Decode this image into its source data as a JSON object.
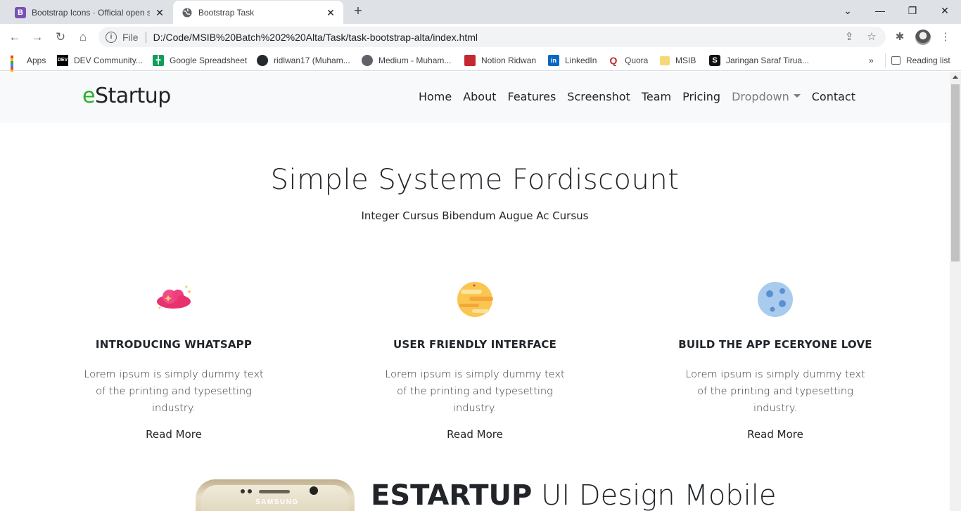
{
  "browser": {
    "tabs": [
      {
        "title": "Bootstrap Icons · Official open sc",
        "favicon": "bootstrap-icon",
        "active": false
      },
      {
        "title": "Bootstrap Task",
        "favicon": "globe-icon",
        "active": true
      }
    ],
    "url_scheme_label": "File",
    "url": "D:/Code/MSIB%20Batch%202%20Alta/Task/task-bootstrap-alta/index.html",
    "bookmarks": [
      {
        "label": "Apps",
        "icon": "apps-grid-icon"
      },
      {
        "label": "DEV Community...",
        "icon": "dev-icon"
      },
      {
        "label": "Google Spreadsheet",
        "icon": "sheets-icon"
      },
      {
        "label": "ridlwan17 (Muham...",
        "icon": "github-icon"
      },
      {
        "label": "Medium - Muham...",
        "icon": "globe-icon"
      },
      {
        "label": "Notion Ridwan",
        "icon": "notion-icon"
      },
      {
        "label": "LinkedIn",
        "icon": "linkedin-icon"
      },
      {
        "label": "Quora",
        "icon": "quora-icon"
      },
      {
        "label": "MSIB",
        "icon": "folder-icon"
      },
      {
        "label": "Jaringan Saraf Tirua...",
        "icon": "s-icon"
      }
    ],
    "overflow_label": "»",
    "reading_list_label": "Reading list"
  },
  "site": {
    "brand_accent": "e",
    "brand_rest": "Startup",
    "nav": [
      "Home",
      "About",
      "Features",
      "Screenshot",
      "Team",
      "Pricing",
      "Dropdown",
      "Contact"
    ],
    "hero_title": "Simple Systeme Fordiscount",
    "hero_subtitle": "Integer Cursus Bibendum Augue Ac Cursus",
    "features": [
      {
        "icon": "cloud-icon",
        "title": "INTRODUCING WHATSAPP",
        "desc": "Lorem ipsum is simply dummy text of the printing and typesetting industry.",
        "more": "Read More"
      },
      {
        "icon": "planet-icon",
        "title": "USER FRIENDLY INTERFACE",
        "desc": "Lorem ipsum is simply dummy text of the printing and typesetting industry.",
        "more": "Read More"
      },
      {
        "icon": "moon-icon",
        "title": "BUILD THE APP ECERYONE LOVE",
        "desc": "Lorem ipsum is simply dummy text of the printing and typesetting industry.",
        "more": "Read More"
      }
    ],
    "section2_strong": "ESTARTUP",
    "section2_light": "UI Design Mobile",
    "phone_logo": "SAMSUNG"
  },
  "colors": {
    "brand_accent": "#2bb02b",
    "nav_bg": "#f8f9fa",
    "muted": "#7c7c7c"
  }
}
